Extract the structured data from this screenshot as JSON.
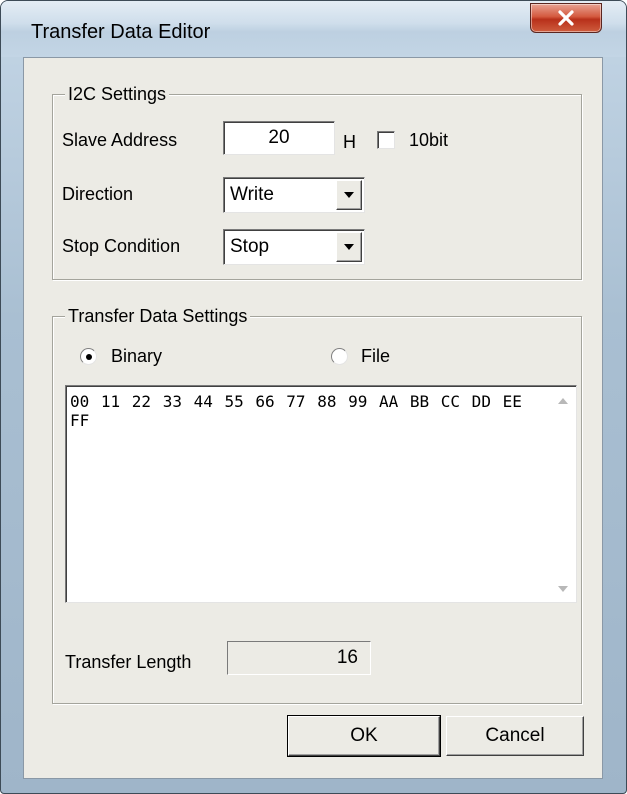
{
  "window": {
    "title": "Transfer Data Editor"
  },
  "i2c": {
    "legend": "I2C Settings",
    "slave_address_label": "Slave Address",
    "slave_address_value": "20",
    "hex_suffix": "H",
    "tenbit_label": "10bit",
    "tenbit_checked": false,
    "direction_label": "Direction",
    "direction_value": "Write",
    "stop_label": "Stop Condition",
    "stop_value": "Stop"
  },
  "transfer": {
    "legend": "Transfer Data Settings",
    "binary_label": "Binary",
    "file_label": "File",
    "selected_mode": "Binary",
    "data_text": "00 11 22 33 44 55 66 77 88 99 AA BB CC DD EE FF",
    "length_label": "Transfer Length",
    "length_value": "16"
  },
  "buttons": {
    "ok": "OK",
    "cancel": "Cancel"
  }
}
